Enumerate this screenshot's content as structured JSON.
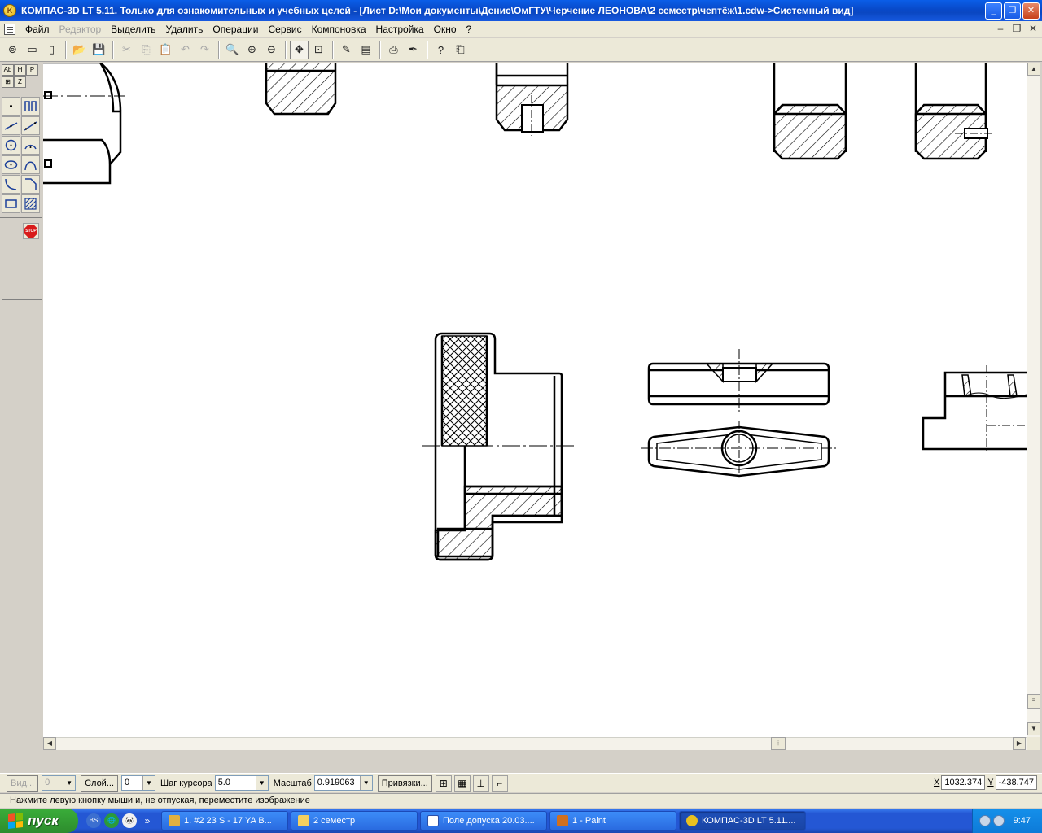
{
  "window": {
    "title": "КОМПАС-3D LT 5.11. Только для ознакомительных и учебных целей - [Лист D:\\Мои документы\\Денис\\ОмГТУ\\Черчение  ЛЕОНОВА\\2 семестр\\чептёж\\1.cdw->Системный вид]",
    "app_icon": "kompas-logo-icon",
    "minimize": "_",
    "restore": "❐",
    "close": "✕"
  },
  "menu": {
    "items": [
      {
        "label": "Файл",
        "enabled": true
      },
      {
        "label": "Редактор",
        "enabled": false
      },
      {
        "label": "Выделить",
        "enabled": true
      },
      {
        "label": "Удалить",
        "enabled": true
      },
      {
        "label": "Операции",
        "enabled": true
      },
      {
        "label": "Сервис",
        "enabled": true
      },
      {
        "label": "Компоновка",
        "enabled": true
      },
      {
        "label": "Настройка",
        "enabled": true
      },
      {
        "label": "Окно",
        "enabled": true
      },
      {
        "label": "?",
        "enabled": true
      }
    ],
    "mdi_min": "–",
    "mdi_restore": "❐",
    "mdi_close": "✕"
  },
  "toolbar": {
    "buttons": [
      "⊚",
      "▭",
      "▯",
      "📂",
      "💾",
      "✂",
      "⎘",
      "📋",
      "↶",
      "↷",
      "🔍",
      "⊕",
      "⊖",
      "✥",
      "⊡",
      "✎",
      "▤",
      "⎙",
      "✒",
      "?",
      "⎗"
    ]
  },
  "leftpanel": {
    "tabs": [
      "Ab",
      "H",
      "P",
      "⊞",
      "Z"
    ]
  },
  "stop": {
    "label": "STOP"
  },
  "parambar": {
    "view_label": "Вид...",
    "view_value": "0",
    "layer_label": "Слой...",
    "layer_value": "0",
    "step_label": "Шаг курсора",
    "step_value": "5.0",
    "scale_label": "Масштаб",
    "scale_value": "0.919063",
    "snaps_label": "Привязки...",
    "x_label": "X",
    "x_value": "1032.374",
    "y_label": "Y",
    "y_value": "-438.747"
  },
  "status": {
    "message": "Нажмите левую кнопку мыши и, не отпуская, переместите изображение"
  },
  "taskbar": {
    "start_label": "пуск",
    "quick_launch": [
      "BS",
      "🌐",
      "🐼"
    ],
    "overflow": "»",
    "tasks": [
      {
        "label": "1. #2 23 S - 17 YA B...",
        "active": false
      },
      {
        "label": "2 семестр",
        "active": false
      },
      {
        "label": "Поле допуска 20.03....",
        "active": false
      },
      {
        "label": "1 - Paint",
        "active": false
      },
      {
        "label": "КОМПАС-3D LT 5.11....",
        "active": true
      }
    ],
    "clock": "9:47"
  },
  "colors": {
    "titlebar": "#0a4fd0",
    "chrome": "#ece9d8",
    "canvas": "#ffffff",
    "taskbar": "#2457d4",
    "start": "#2d8c2d"
  }
}
